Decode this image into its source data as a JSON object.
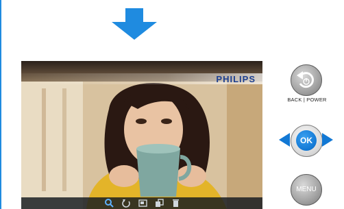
{
  "screen": {
    "brand": "PHILIPS",
    "toolbar_icons": [
      "zoom-icon",
      "rotate-icon",
      "resize-icon",
      "copy-icon",
      "delete-icon"
    ]
  },
  "controls": {
    "back_power_label": "BACK | POWER",
    "ok_label": "OK",
    "menu_label": "MENU"
  },
  "colors": {
    "accent_blue": "#1278d4",
    "brand_blue": "#1d3f8f",
    "arrow_blue": "#1f8be0"
  }
}
